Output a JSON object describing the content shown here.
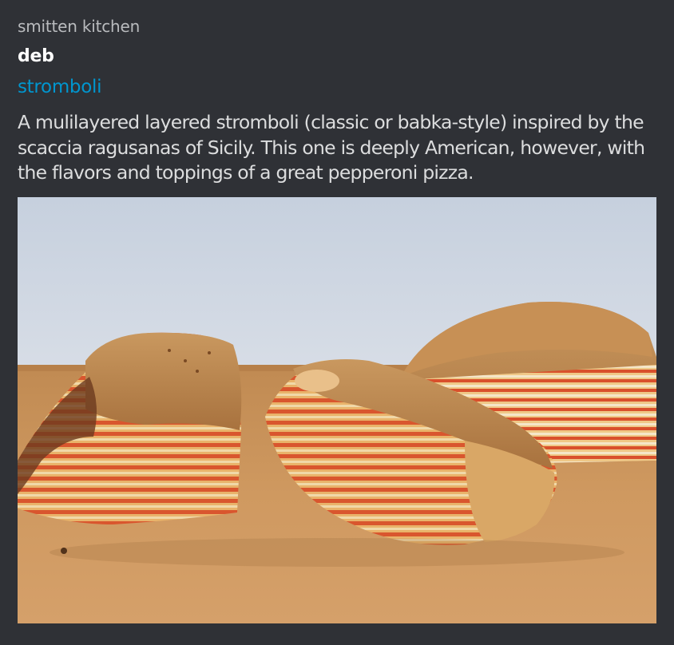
{
  "embed": {
    "provider": "smitten kitchen",
    "author": "deb",
    "title": "stromboli",
    "description": "A mulilayered layered stromboli (classic or babka-style) inspired by the scaccia ragusanas of Sicily. This one is deeply American, however, with the flavors and toppings of a great pepperoni pizza.",
    "image_alt": "stromboli photo"
  },
  "colors": {
    "background": "#2f3136",
    "provider_text": "#b9bbbe",
    "author_text": "#ffffff",
    "title_link": "#0096cf",
    "description_text": "#dcddde"
  }
}
